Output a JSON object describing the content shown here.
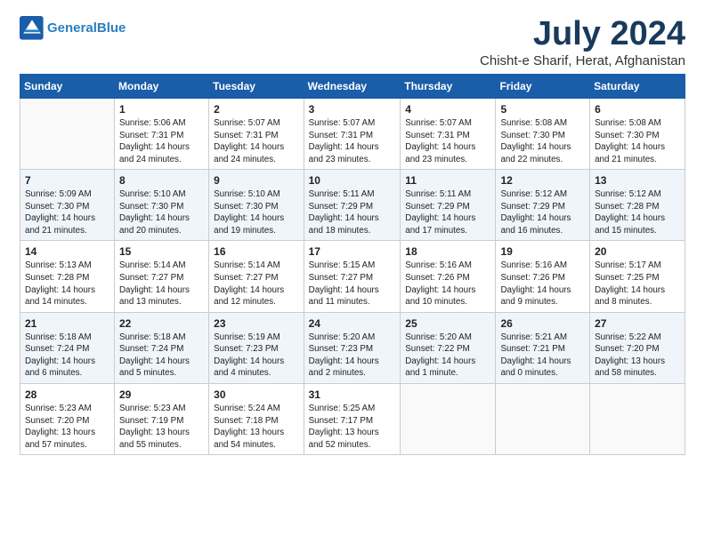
{
  "header": {
    "logo_line1": "General",
    "logo_line2": "Blue",
    "title": "July 2024",
    "subtitle": "Chisht-e Sharif, Herat, Afghanistan"
  },
  "weekdays": [
    "Sunday",
    "Monday",
    "Tuesday",
    "Wednesday",
    "Thursday",
    "Friday",
    "Saturday"
  ],
  "weeks": [
    [
      {
        "day": "",
        "info": ""
      },
      {
        "day": "1",
        "info": "Sunrise: 5:06 AM\nSunset: 7:31 PM\nDaylight: 14 hours\nand 24 minutes."
      },
      {
        "day": "2",
        "info": "Sunrise: 5:07 AM\nSunset: 7:31 PM\nDaylight: 14 hours\nand 24 minutes."
      },
      {
        "day": "3",
        "info": "Sunrise: 5:07 AM\nSunset: 7:31 PM\nDaylight: 14 hours\nand 23 minutes."
      },
      {
        "day": "4",
        "info": "Sunrise: 5:07 AM\nSunset: 7:31 PM\nDaylight: 14 hours\nand 23 minutes."
      },
      {
        "day": "5",
        "info": "Sunrise: 5:08 AM\nSunset: 7:30 PM\nDaylight: 14 hours\nand 22 minutes."
      },
      {
        "day": "6",
        "info": "Sunrise: 5:08 AM\nSunset: 7:30 PM\nDaylight: 14 hours\nand 21 minutes."
      }
    ],
    [
      {
        "day": "7",
        "info": "Sunrise: 5:09 AM\nSunset: 7:30 PM\nDaylight: 14 hours\nand 21 minutes."
      },
      {
        "day": "8",
        "info": "Sunrise: 5:10 AM\nSunset: 7:30 PM\nDaylight: 14 hours\nand 20 minutes."
      },
      {
        "day": "9",
        "info": "Sunrise: 5:10 AM\nSunset: 7:30 PM\nDaylight: 14 hours\nand 19 minutes."
      },
      {
        "day": "10",
        "info": "Sunrise: 5:11 AM\nSunset: 7:29 PM\nDaylight: 14 hours\nand 18 minutes."
      },
      {
        "day": "11",
        "info": "Sunrise: 5:11 AM\nSunset: 7:29 PM\nDaylight: 14 hours\nand 17 minutes."
      },
      {
        "day": "12",
        "info": "Sunrise: 5:12 AM\nSunset: 7:29 PM\nDaylight: 14 hours\nand 16 minutes."
      },
      {
        "day": "13",
        "info": "Sunrise: 5:12 AM\nSunset: 7:28 PM\nDaylight: 14 hours\nand 15 minutes."
      }
    ],
    [
      {
        "day": "14",
        "info": "Sunrise: 5:13 AM\nSunset: 7:28 PM\nDaylight: 14 hours\nand 14 minutes."
      },
      {
        "day": "15",
        "info": "Sunrise: 5:14 AM\nSunset: 7:27 PM\nDaylight: 14 hours\nand 13 minutes."
      },
      {
        "day": "16",
        "info": "Sunrise: 5:14 AM\nSunset: 7:27 PM\nDaylight: 14 hours\nand 12 minutes."
      },
      {
        "day": "17",
        "info": "Sunrise: 5:15 AM\nSunset: 7:27 PM\nDaylight: 14 hours\nand 11 minutes."
      },
      {
        "day": "18",
        "info": "Sunrise: 5:16 AM\nSunset: 7:26 PM\nDaylight: 14 hours\nand 10 minutes."
      },
      {
        "day": "19",
        "info": "Sunrise: 5:16 AM\nSunset: 7:26 PM\nDaylight: 14 hours\nand 9 minutes."
      },
      {
        "day": "20",
        "info": "Sunrise: 5:17 AM\nSunset: 7:25 PM\nDaylight: 14 hours\nand 8 minutes."
      }
    ],
    [
      {
        "day": "21",
        "info": "Sunrise: 5:18 AM\nSunset: 7:24 PM\nDaylight: 14 hours\nand 6 minutes."
      },
      {
        "day": "22",
        "info": "Sunrise: 5:18 AM\nSunset: 7:24 PM\nDaylight: 14 hours\nand 5 minutes."
      },
      {
        "day": "23",
        "info": "Sunrise: 5:19 AM\nSunset: 7:23 PM\nDaylight: 14 hours\nand 4 minutes."
      },
      {
        "day": "24",
        "info": "Sunrise: 5:20 AM\nSunset: 7:23 PM\nDaylight: 14 hours\nand 2 minutes."
      },
      {
        "day": "25",
        "info": "Sunrise: 5:20 AM\nSunset: 7:22 PM\nDaylight: 14 hours\nand 1 minute."
      },
      {
        "day": "26",
        "info": "Sunrise: 5:21 AM\nSunset: 7:21 PM\nDaylight: 14 hours\nand 0 minutes."
      },
      {
        "day": "27",
        "info": "Sunrise: 5:22 AM\nSunset: 7:20 PM\nDaylight: 13 hours\nand 58 minutes."
      }
    ],
    [
      {
        "day": "28",
        "info": "Sunrise: 5:23 AM\nSunset: 7:20 PM\nDaylight: 13 hours\nand 57 minutes."
      },
      {
        "day": "29",
        "info": "Sunrise: 5:23 AM\nSunset: 7:19 PM\nDaylight: 13 hours\nand 55 minutes."
      },
      {
        "day": "30",
        "info": "Sunrise: 5:24 AM\nSunset: 7:18 PM\nDaylight: 13 hours\nand 54 minutes."
      },
      {
        "day": "31",
        "info": "Sunrise: 5:25 AM\nSunset: 7:17 PM\nDaylight: 13 hours\nand 52 minutes."
      },
      {
        "day": "",
        "info": ""
      },
      {
        "day": "",
        "info": ""
      },
      {
        "day": "",
        "info": ""
      }
    ]
  ]
}
